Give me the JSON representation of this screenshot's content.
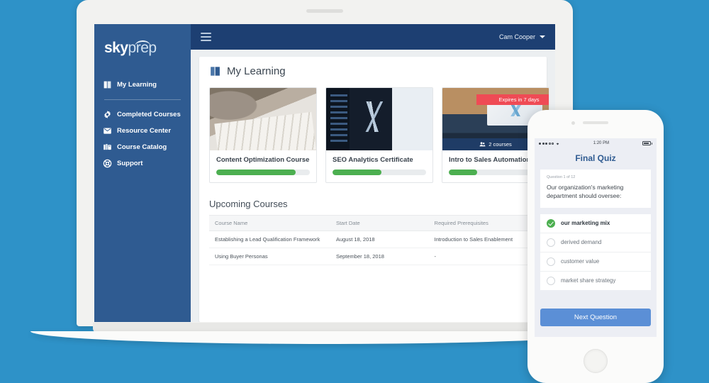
{
  "colors": {
    "background": "#2e92c8",
    "sidebar": "#2f5b91",
    "topbar": "#1d3f72",
    "progress": "#4caf50",
    "badge_red": "#ef4b55",
    "button_blue": "#5b8fd6"
  },
  "sidebar": {
    "logo": {
      "part1": "sky",
      "part2": "prep"
    },
    "primary": [
      {
        "label": "My Learning",
        "icon": "book-icon"
      }
    ],
    "items": [
      {
        "label": "Completed Courses",
        "icon": "gear-icon"
      },
      {
        "label": "Resource Center",
        "icon": "inbox-icon"
      },
      {
        "label": "Course Catalog",
        "icon": "books-icon"
      },
      {
        "label": "Support",
        "icon": "lifering-icon"
      }
    ]
  },
  "topbar": {
    "menu_icon": "hamburger-icon",
    "user_name": "Cam Cooper",
    "caret_icon": "chevron-down-icon"
  },
  "page": {
    "title": "My Learning",
    "title_icon": "book-icon"
  },
  "courses": [
    {
      "title": "Content Optimization Course",
      "progress": 85,
      "badge": null,
      "course_count": null
    },
    {
      "title": "SEO Analytics Certificate",
      "progress": 52,
      "badge": null,
      "course_count": null
    },
    {
      "title": "Intro to Sales Automation",
      "progress": 30,
      "badge": "Expires in 7 days",
      "course_count": "2 courses",
      "count_icon": "people-icon"
    }
  ],
  "upcoming": {
    "title": "Upcoming Courses",
    "columns": [
      "Course Name",
      "Start Date",
      "Required Prerequisites"
    ],
    "rows": [
      [
        "Establishing a Lead Qualification Framework",
        "August 18, 2018",
        "Introduction to Sales Enablement"
      ],
      [
        "Using Buyer Personas",
        "September 18, 2018",
        "-"
      ]
    ]
  },
  "phone": {
    "status": {
      "time": "1:20 PM",
      "signal_icon": "signal-dots-icon",
      "wifi_icon": "wifi-icon",
      "battery_icon": "battery-icon"
    },
    "quiz_title": "Final Quiz",
    "question_counter": "Question 1 of 12",
    "question_text": "Our organization's marketing department should oversee:",
    "answers": [
      {
        "label": "our marketing mix",
        "selected": true
      },
      {
        "label": "derived demand",
        "selected": false
      },
      {
        "label": "customer value",
        "selected": false
      },
      {
        "label": "market share strategy",
        "selected": false
      }
    ],
    "next_label": "Next Question"
  }
}
